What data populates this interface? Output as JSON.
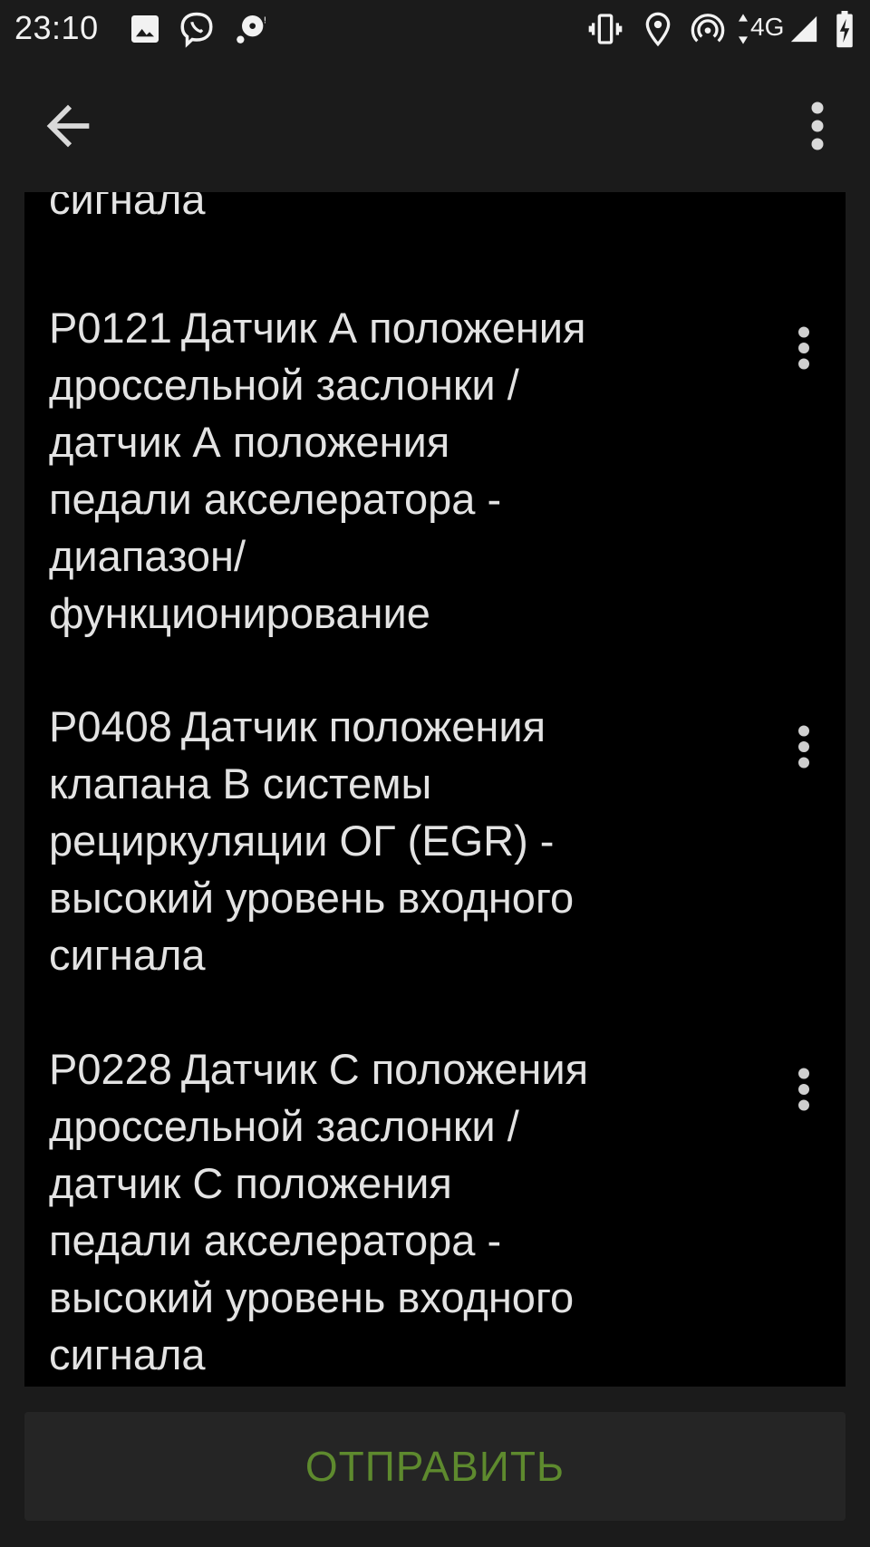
{
  "status_bar": {
    "time": "23:10",
    "network": "4G",
    "icons": [
      "image-icon",
      "viber-icon",
      "chat-bubble-icon",
      "vibrate-icon",
      "location-icon",
      "hotspot-icon",
      "data-arrows-icon",
      "signal-icon",
      "battery-charging-icon"
    ]
  },
  "app_bar": {
    "back_icon": "arrow-back-icon",
    "menu_icon": "more-vert-icon"
  },
  "list": {
    "partial_tail": "сигнала",
    "items": [
      {
        "code": "P0121",
        "lines": [
          "Датчик А положения",
          "дроссельной заслонки /",
          "датчик А положения",
          "педали акселератора -",
          "диапазон/",
          "функционирование"
        ]
      },
      {
        "code": "P0408",
        "lines": [
          "Датчик положения",
          "клапана В системы",
          "рециркуляции ОГ (EGR) -",
          "высокий уровень входного",
          "сигнала"
        ]
      },
      {
        "code": "P0228",
        "lines": [
          "Датчик С положения",
          "дроссельной заслонки /",
          "датчик С положения",
          "педали акселератора -",
          "высокий уровень входного",
          "сигнала"
        ]
      }
    ]
  },
  "send_button": {
    "label": "ОТПРАВИТЬ"
  },
  "colors": {
    "background": "#1b1b1b",
    "list_background": "#000000",
    "text": "#e3e3e3",
    "accent": "#5e8a2e"
  }
}
